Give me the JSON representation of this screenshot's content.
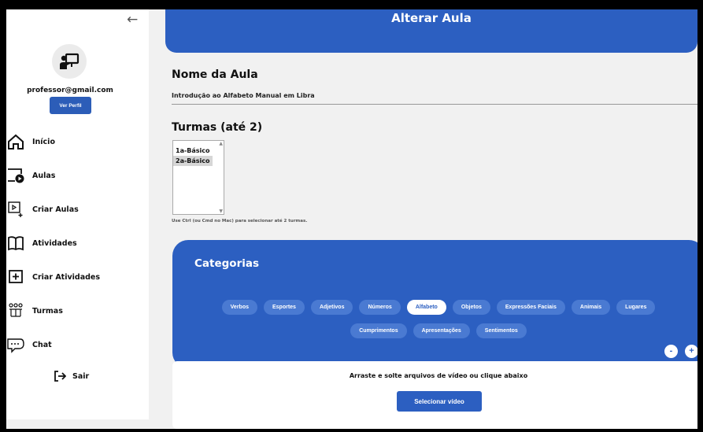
{
  "sidebar": {
    "email": "professor@gmail.com",
    "profile_button": "Ver Perfil",
    "items": [
      {
        "label": "Início",
        "icon": "home-icon"
      },
      {
        "label": "Aulas",
        "icon": "video-lesson-icon"
      },
      {
        "label": "Criar Aulas",
        "icon": "add-video-icon"
      },
      {
        "label": "Atividades",
        "icon": "book-icon"
      },
      {
        "label": "Criar Atividades",
        "icon": "add-square-icon"
      },
      {
        "label": "Turmas",
        "icon": "group-icon"
      },
      {
        "label": "Chat",
        "icon": "chat-bubble-icon"
      }
    ],
    "logout": "Sair"
  },
  "header": {
    "title": "Alterar Aula"
  },
  "form": {
    "name_label": "Nome da Aula",
    "name_value": "Introdução ao Alfabeto Manual em Libra",
    "turmas_label": "Turmas (até 2)",
    "turmas_options": [
      "1a-Básico",
      "2a-Básico"
    ],
    "turmas_selected": "2a-Básico",
    "turmas_hint": "Use Ctrl (ou Cmd no Mac) para selecionar até 2 turmas."
  },
  "categories": {
    "title": "Categorias",
    "row1": [
      "Verbos",
      "Esportes",
      "Adjetivos",
      "Números",
      "Alfabeto",
      "Objetos",
      "Expressões Faciais",
      "Animais",
      "Lugares"
    ],
    "row2": [
      "Cumprimentos",
      "Apresentações",
      "Sentimentos"
    ],
    "active": "Alfabeto",
    "minus": "-",
    "plus": "+"
  },
  "upload": {
    "text": "Arraste e solte arquivos de vídeo ou clique abaixo",
    "button": "Selecionar vídeo"
  },
  "colors": {
    "primary": "#2c5fc1",
    "chip": "#4a7ad2",
    "background": "#f1f1f1"
  }
}
